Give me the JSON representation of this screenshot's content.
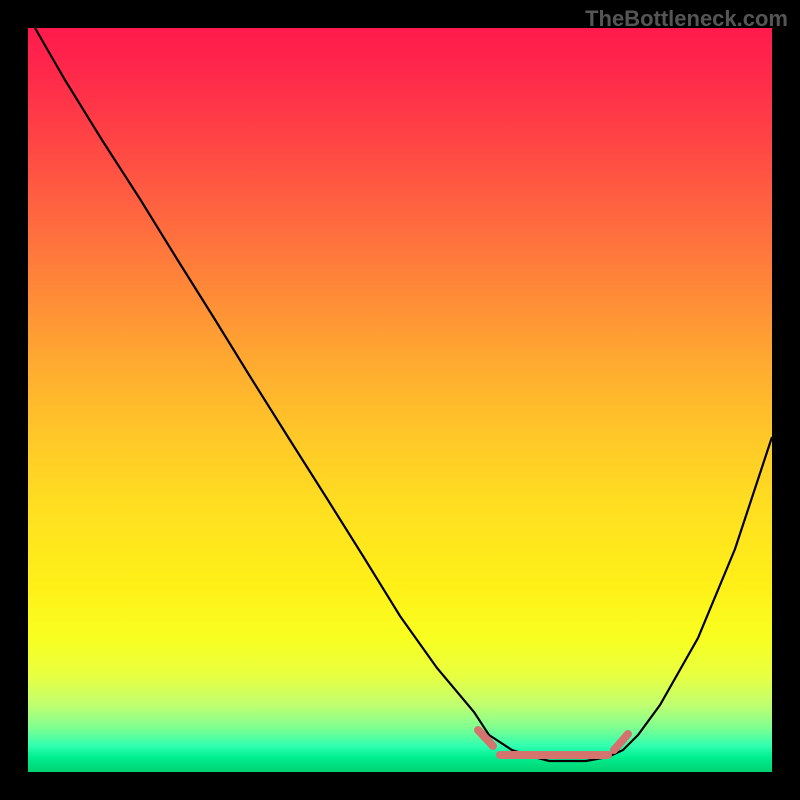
{
  "watermark": "TheBottleneck.com",
  "chart_data": {
    "type": "line",
    "title": "",
    "xlabel": "",
    "ylabel": "",
    "xlim": [
      0,
      100
    ],
    "ylim": [
      0,
      100
    ],
    "grid": false,
    "legend": false,
    "series": [
      {
        "name": "bottleneck-curve",
        "x": [
          1,
          5,
          10,
          15,
          20,
          25,
          30,
          35,
          40,
          45,
          50,
          55,
          60,
          62,
          65,
          68,
          70,
          72,
          75,
          78,
          80,
          82,
          85,
          90,
          95,
          100
        ],
        "y": [
          100,
          93,
          85,
          77,
          69,
          61,
          53,
          45,
          37,
          29,
          21,
          14,
          8,
          5,
          3,
          2,
          1.5,
          1.5,
          1.5,
          2,
          3,
          5,
          9,
          18,
          30,
          45
        ]
      }
    ],
    "markers": {
      "name": "highlight-range",
      "color": "#d5736f",
      "segments": [
        {
          "x": [
            60,
            62
          ],
          "y": [
            5,
            3
          ]
        },
        {
          "x": [
            63,
            78
          ],
          "y": [
            2,
            2
          ]
        },
        {
          "x": [
            78,
            80
          ],
          "y": [
            2.5,
            4
          ]
        }
      ]
    },
    "background_gradient": {
      "top": "#ff1a4d",
      "mid": "#ffe020",
      "bottom": "#00d070"
    }
  }
}
